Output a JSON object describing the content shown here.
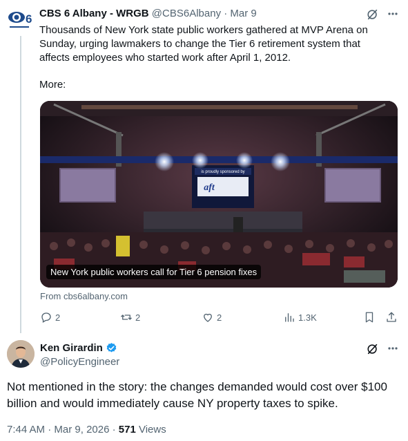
{
  "tweet1": {
    "author_name": "CBS 6 Albany - WRGB",
    "handle": "@CBS6Albany",
    "separator": "·",
    "date": "Mar 9",
    "text": "Thousands of New York state public workers gathered at MVP Arena on Sunday, urging lawmakers to change the Tier 6 retirement system that affects employees who started work after April 1, 2012.",
    "more_label": "More:",
    "card": {
      "caption": "New York public workers call for Tier 6 pension fixes",
      "source": "From cbs6albany.com",
      "screen_banner": "is proudly sponsored by",
      "screen_logo": "aft"
    },
    "actions": {
      "replies": "2",
      "reposts": "2",
      "likes": "2",
      "views": "1.3K"
    },
    "avatar_text": "6"
  },
  "tweet2": {
    "author_name": "Ken Girardin",
    "handle": "@PolicyEngineer",
    "text": "Not mentioned in the story: the changes demanded would cost over $100 billion and would immediately cause NY property taxes to spike.",
    "time": "7:44 AM",
    "separator": "·",
    "date": "Mar 9, 2026",
    "views_count": "571",
    "views_label": "Views"
  },
  "colors": {
    "text": "#0f1419",
    "secondary": "#536471",
    "verified": "#1d9bf0",
    "thread_line": "#cfd9de"
  }
}
